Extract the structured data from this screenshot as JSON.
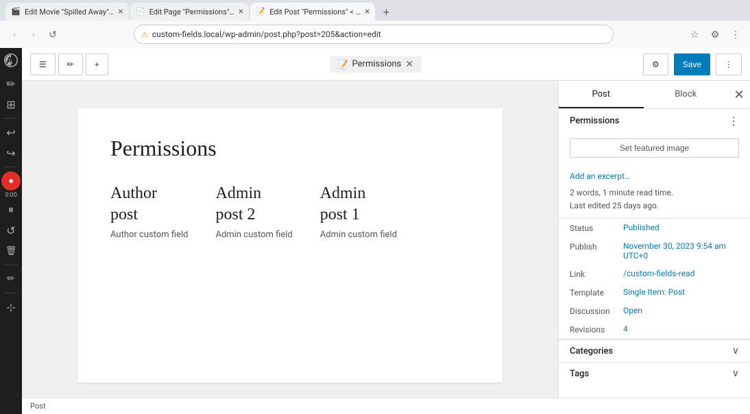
{
  "browser": {
    "tabs": [
      {
        "id": "tab1",
        "title": "Edit Movie \"Spilled Away\"…",
        "favicon": "🎬",
        "active": false
      },
      {
        "id": "tab2",
        "title": "Edit Page \"Permissions\"…",
        "favicon": "📄",
        "active": false
      },
      {
        "id": "tab3",
        "title": "Edit Post \"Permissions\" < …",
        "favicon": "📝",
        "active": true
      },
      {
        "id": "tab4",
        "title": "",
        "favicon": "",
        "active": false
      }
    ],
    "url": "custom-fields.local/wp-admin/post.php?post=205&action=edit",
    "security": "Not Secure"
  },
  "topbar": {
    "breadcrumb": "Permissions",
    "close_label": "✕",
    "save_label": "Save",
    "settings_label": "⚙"
  },
  "document": {
    "title": "Permissions",
    "blocks": [
      {
        "heading_line1": "Author",
        "heading_line2": "post",
        "subtext": "Author custom field"
      },
      {
        "heading_line1": "Admin",
        "heading_line2": "post 2",
        "subtext": "Admin custom field"
      },
      {
        "heading_line1": "Admin",
        "heading_line2": "post 1",
        "subtext": "Admin custom field"
      }
    ]
  },
  "sidebar": {
    "tabs": [
      {
        "id": "post",
        "label": "Post",
        "active": true
      },
      {
        "id": "block",
        "label": "Block",
        "active": false
      }
    ],
    "permissions_section_label": "Permissions",
    "featured_image_btn": "Set featured image",
    "add_excerpt_link": "Add an excerpt…",
    "word_count": "2 words, 1 minute read time.",
    "last_edited": "Last edited 25 days ago.",
    "meta": [
      {
        "label": "Status",
        "value": "Published",
        "link": true
      },
      {
        "label": "Publish",
        "value": "November 30, 2023 9:54 am UTC+0",
        "link": true
      },
      {
        "label": "Link",
        "value": "/custom-fields-read",
        "link": true
      },
      {
        "label": "Template",
        "value": "Single Item: Post",
        "link": true
      },
      {
        "label": "Discussion",
        "value": "Open",
        "link": true
      },
      {
        "label": "Revisions",
        "value": "4",
        "link": true
      }
    ],
    "categories_label": "Categories",
    "tags_label": "Tags"
  },
  "recording": {
    "time": "0:00"
  },
  "statusbar": {
    "text": "Post"
  },
  "toolbar": {
    "wp_icon": "W",
    "buttons": [
      "✏",
      "⊞",
      "↩",
      "↪",
      "⋯"
    ]
  }
}
